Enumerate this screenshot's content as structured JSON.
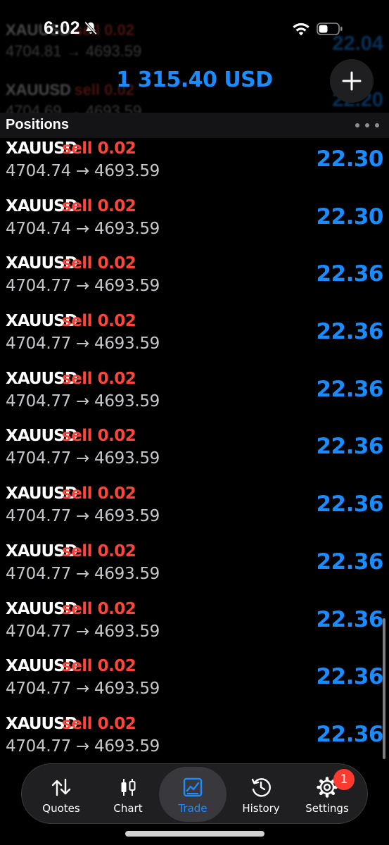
{
  "status_bar": {
    "time": "6:02"
  },
  "background_rows": [
    {
      "symbol": "XAUUSD",
      "side": "sell 0.02",
      "prices": "4704.81 → 4693.59",
      "profit": "22.04"
    },
    {
      "symbol": "XAUUSD",
      "side": "sell 0.02",
      "prices": "4704.69 → 4693.59",
      "profit": "22.20"
    }
  ],
  "balance": "1 315.40 USD",
  "section": {
    "title": "Positions"
  },
  "positions": [
    {
      "symbol": "XAUUSD",
      "side": "sell 0.02",
      "prices": "4704.74 → 4693.59",
      "profit": "22.30"
    },
    {
      "symbol": "XAUUSD",
      "side": "sell 0.02",
      "prices": "4704.74 → 4693.59",
      "profit": "22.30"
    },
    {
      "symbol": "XAUUSD",
      "side": "sell 0.02",
      "prices": "4704.77 → 4693.59",
      "profit": "22.36"
    },
    {
      "symbol": "XAUUSD",
      "side": "sell 0.02",
      "prices": "4704.77 → 4693.59",
      "profit": "22.36"
    },
    {
      "symbol": "XAUUSD",
      "side": "sell 0.02",
      "prices": "4704.77 → 4693.59",
      "profit": "22.36"
    },
    {
      "symbol": "XAUUSD",
      "side": "sell 0.02",
      "prices": "4704.77 → 4693.59",
      "profit": "22.36"
    },
    {
      "symbol": "XAUUSD",
      "side": "sell 0.02",
      "prices": "4704.77 → 4693.59",
      "profit": "22.36"
    },
    {
      "symbol": "XAUUSD",
      "side": "sell 0.02",
      "prices": "4704.77 → 4693.59",
      "profit": "22.36"
    },
    {
      "symbol": "XAUUSD",
      "side": "sell 0.02",
      "prices": "4704.77 → 4693.59",
      "profit": "22.36"
    },
    {
      "symbol": "XAUUSD",
      "side": "sell 0.02",
      "prices": "4704.77 → 4693.59",
      "profit": "22.36"
    },
    {
      "symbol": "XAUUSD",
      "side": "sell 0.02",
      "prices": "4704.77 → 4693.59",
      "profit": "22.36"
    }
  ],
  "tabs": [
    {
      "label": "Quotes",
      "icon": "quotes-arrows-icon",
      "active": false
    },
    {
      "label": "Chart",
      "icon": "candlestick-chart-icon",
      "active": false
    },
    {
      "label": "Trade",
      "icon": "trade-chart-icon",
      "active": true
    },
    {
      "label": "History",
      "icon": "history-clock-icon",
      "active": false
    },
    {
      "label": "Settings",
      "icon": "gear-icon",
      "active": false
    }
  ],
  "settings_badge": "1",
  "colors": {
    "accent": "#1a8cff",
    "sell": "#ff453a",
    "badge": "#ff3b30"
  }
}
